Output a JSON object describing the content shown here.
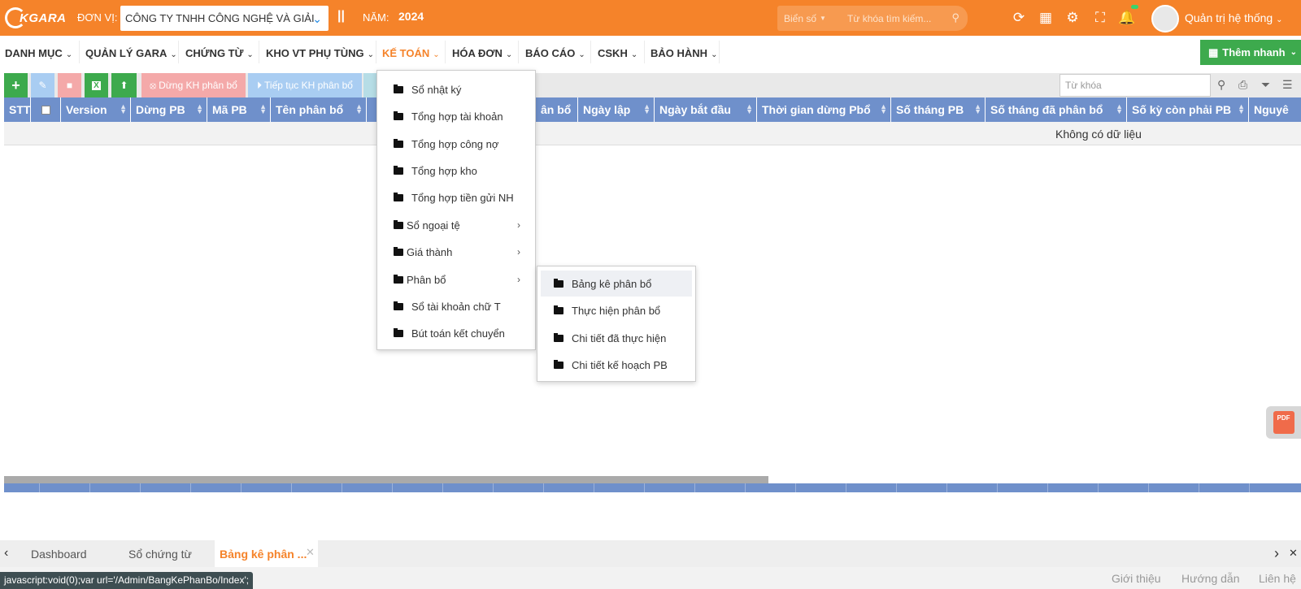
{
  "topbar": {
    "logo_text": "KGARA",
    "unit_label": "ĐƠN VỊ:",
    "unit_value": "CÔNG TY TNHH CÔNG NGHỆ VÀ GIẢI",
    "separator": "||",
    "year_label": "NĂM:",
    "year_value": "2024",
    "plate_select": "Biển số",
    "search_placeholder": "Từ khóa tìm kiếm...",
    "admin_name": "Quản trị hệ thống",
    "accent_color": "#f5832a"
  },
  "menu": {
    "items": [
      {
        "label": "DANH MỤC"
      },
      {
        "label": "QUẢN LÝ GARA"
      },
      {
        "label": "CHỨNG TỪ"
      },
      {
        "label": "KHO VT PHỤ TÙNG"
      },
      {
        "label": "KẾ TOÁN",
        "active": true
      },
      {
        "label": "HÓA ĐƠN"
      },
      {
        "label": "BÁO CÁO"
      },
      {
        "label": "CSKH"
      },
      {
        "label": "BẢO HÀNH"
      }
    ],
    "quick_add": "Thêm nhanh"
  },
  "toolbar": {
    "stop_plan": "Dừng KH phân bổ",
    "continue_plan": "Tiếp tục KH phân bổ",
    "keyword_placeholder": "Từ khóa"
  },
  "table": {
    "columns": [
      "STT",
      "",
      "Version",
      "Dừng PB",
      "Mã PB",
      "Tên phân bổ",
      "",
      "ân bổ",
      "Ngày lập",
      "Ngày bắt đầu",
      "Thời gian dừng Pbổ",
      "Số tháng PB",
      "Số tháng đã phân bổ",
      "Số kỳ còn phải PB",
      "Nguyê"
    ],
    "empty_text": "Không có dữ liệu"
  },
  "ketoan_menu": {
    "items": [
      {
        "label": "Sổ nhật ký"
      },
      {
        "label": "Tổng hợp tài khoản"
      },
      {
        "label": "Tổng hợp công nợ"
      },
      {
        "label": "Tổng hợp kho"
      },
      {
        "label": "Tổng hợp tiền gửi NH"
      },
      {
        "label": "Sổ ngoại tệ",
        "submenu": true
      },
      {
        "label": "Giá thành",
        "submenu": true
      },
      {
        "label": "Phân bổ",
        "submenu": true
      },
      {
        "label": "Sổ tài khoản chữ T"
      },
      {
        "label": "Bút toán kết chuyển"
      }
    ]
  },
  "phanbo_menu": {
    "items": [
      {
        "label": "Bảng kê phân bổ"
      },
      {
        "label": "Thực hiện phân bổ"
      },
      {
        "label": "Chi tiết đã thực hiện"
      },
      {
        "label": "Chi tiết kế hoạch PB"
      }
    ]
  },
  "pdf_label": "PDF",
  "tabs": [
    {
      "label": "Dashboard"
    },
    {
      "label": "Sổ chứng từ"
    },
    {
      "label": "Bảng kê phân ..."
    }
  ],
  "status": {
    "url": "javascript:void(0);var url='/Admin/BangKePhanBo/Index';",
    "links": [
      "Giới thiệu",
      "Hướng dẫn",
      "Liên hệ"
    ]
  }
}
